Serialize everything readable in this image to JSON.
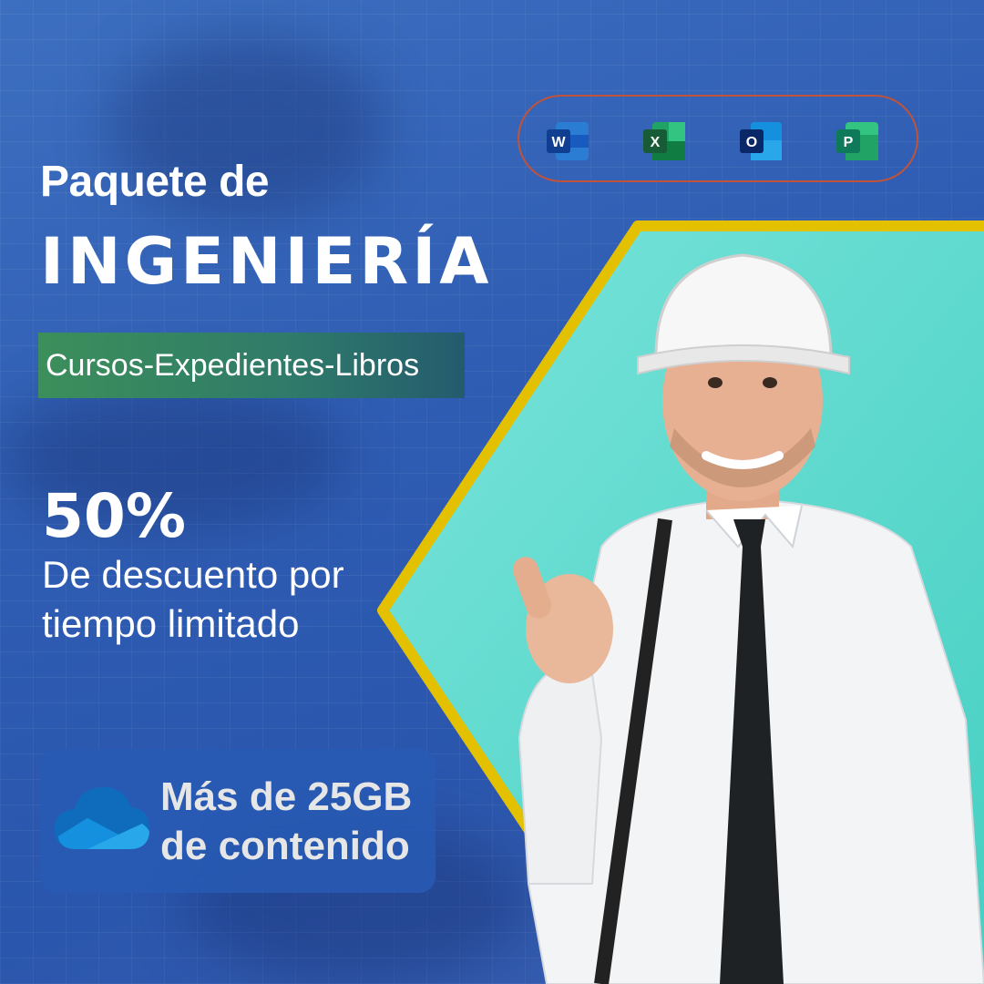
{
  "headline": {
    "line1": "Paquete de",
    "line2": "INGENIERÍA"
  },
  "tagline": "Cursos-Expedientes-Libros",
  "offer": {
    "percent": "50%",
    "text_line1": "De descuento por",
    "text_line2": "tiempo limitado"
  },
  "storage": {
    "line1": "Más de 25GB",
    "line2": "de contenido",
    "icon": "cloud-icon"
  },
  "apps": [
    {
      "name": "word-icon",
      "letter": "W",
      "color": "#185abd"
    },
    {
      "name": "excel-icon",
      "letter": "X",
      "color": "#107c41"
    },
    {
      "name": "outlook-icon",
      "letter": "O",
      "color": "#0f6cbd"
    },
    {
      "name": "project-icon",
      "letter": "P",
      "color": "#118066"
    }
  ],
  "colors": {
    "background": "#2f5db3",
    "hexagon_fill": "#6fdcd2",
    "hexagon_border": "#e4c100",
    "tagline_green": "#3c8f5a",
    "pill_border": "#c0533a"
  }
}
